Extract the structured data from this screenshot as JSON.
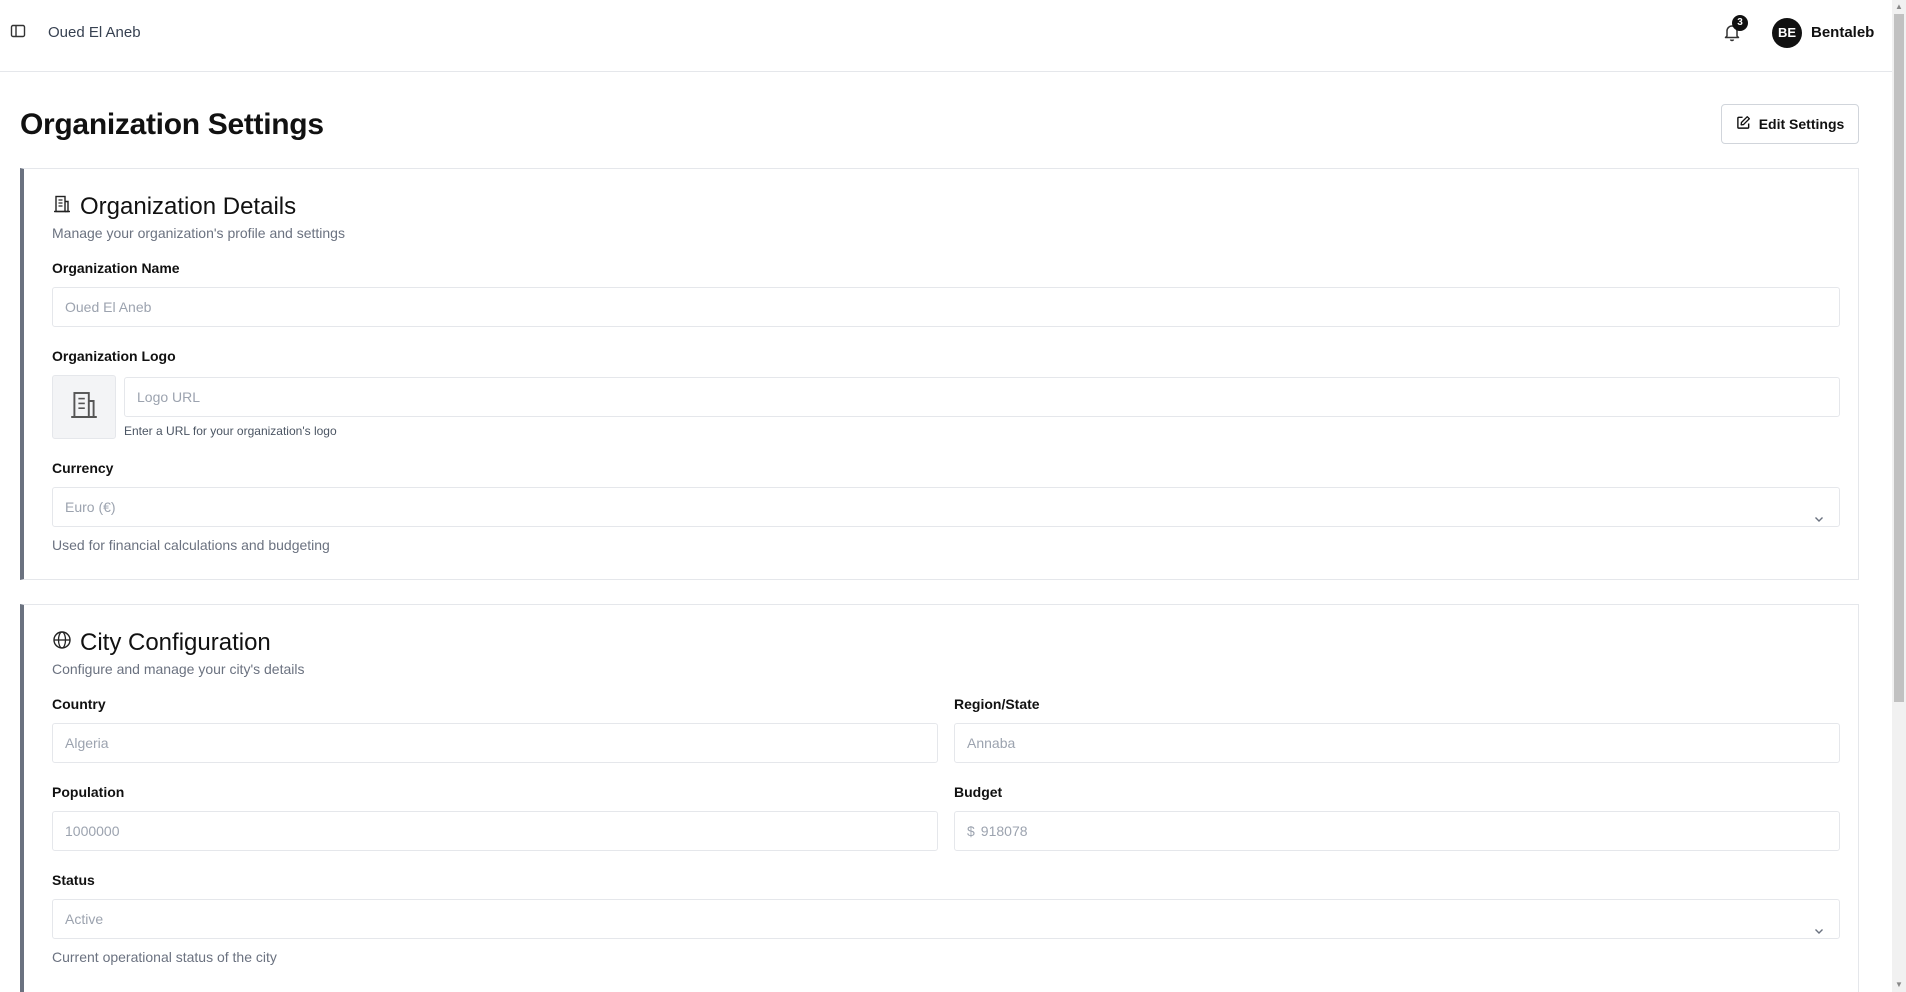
{
  "header": {
    "org_name": "Oued El Aneb",
    "notification_count": "3",
    "avatar_initials": "BE",
    "username": "Bentaleb"
  },
  "page": {
    "title": "Organization Settings",
    "edit_button_label": "Edit Settings"
  },
  "org_details": {
    "title": "Organization Details",
    "subtitle": "Manage your organization's profile and settings",
    "name_label": "Organization Name",
    "name_value": "Oued El Aneb",
    "logo_label": "Organization Logo",
    "logo_placeholder": "Logo URL",
    "logo_hint": "Enter a URL for your organization's logo",
    "currency_label": "Currency",
    "currency_value": "Euro (€)",
    "currency_hint": "Used for financial calculations and budgeting"
  },
  "city_config": {
    "title": "City Configuration",
    "subtitle": "Configure and manage your city's details",
    "country_label": "Country",
    "country_value": "Algeria",
    "region_label": "Region/State",
    "region_value": "Annaba",
    "population_label": "Population",
    "population_value": "1000000",
    "budget_label": "Budget",
    "budget_currency_symbol": "$",
    "budget_value": "918078",
    "status_label": "Status",
    "status_value": "Active",
    "status_hint": "Current operational status of the city"
  },
  "icons": {
    "sidebar_toggle": "sidebar-toggle-icon",
    "bell": "bell-icon",
    "edit": "edit-icon",
    "building": "building-icon",
    "globe": "globe-icon",
    "chevron": "chevron-down-icon"
  },
  "colors": {
    "card_accent": "#6b7280",
    "border": "#e5e7eb",
    "text_primary": "#111111",
    "text_muted": "#6b7280"
  }
}
